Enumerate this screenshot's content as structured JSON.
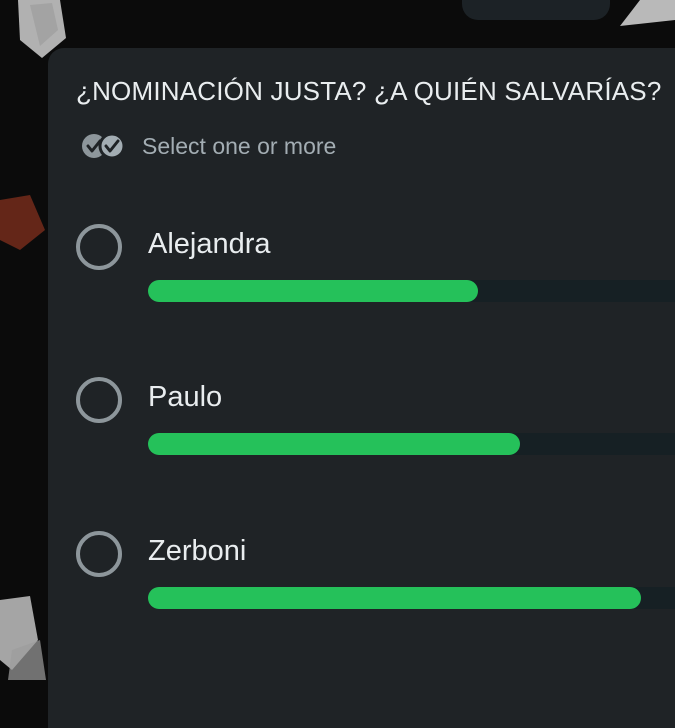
{
  "poll": {
    "question": "¿NOMINACIÓN JUSTA? ¿A QUIÉN SALVARÍAS?",
    "selection_hint": "Select one or more",
    "options": [
      {
        "label": "Alejandra",
        "vote_fraction": 0.59
      },
      {
        "label": "Paulo",
        "vote_fraction": 0.665
      },
      {
        "label": "Zerboni",
        "vote_fraction": 0.88
      }
    ]
  },
  "colors": {
    "card_background": "#1f2326",
    "bar_fill": "#25c15a",
    "bar_track": "#162024",
    "radio_border": "#8d969b",
    "primary_text": "#e9edef",
    "secondary_text": "#a3adb3"
  },
  "icons": {
    "hint_icon": "double-check-icon",
    "option_icon": "radio-unchecked-icon"
  }
}
